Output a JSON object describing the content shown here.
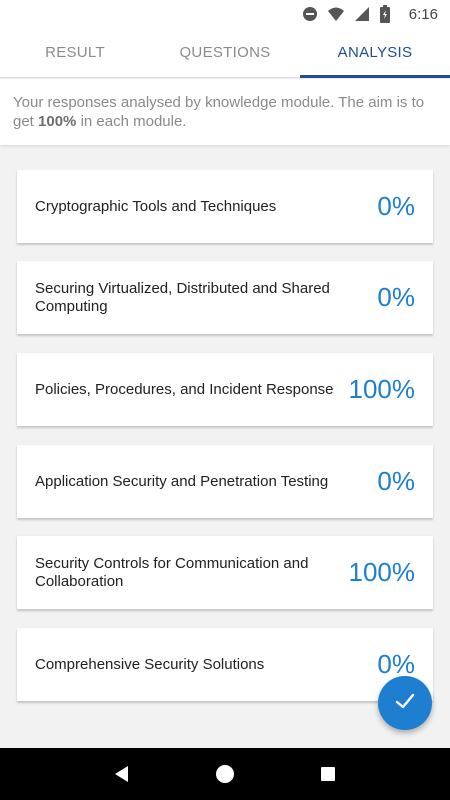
{
  "status_bar": {
    "time": "6:16",
    "icons": [
      "do-not-disturb-icon",
      "wifi-icon",
      "signal-icon",
      "battery-icon"
    ]
  },
  "tabs": [
    {
      "label": "RESULT",
      "active": false
    },
    {
      "label": "QUESTIONS",
      "active": false
    },
    {
      "label": "ANALYSIS",
      "active": true
    }
  ],
  "intro": {
    "text_before": "Your responses analysed by knowledge module. The aim is to get ",
    "bold": "100%",
    "text_after": " in each module."
  },
  "modules": [
    {
      "name": "Cryptographic Tools and Techniques",
      "score": "0%"
    },
    {
      "name": "Securing Virtualized, Distributed and Shared Computing",
      "score": "0%"
    },
    {
      "name": "Policies, Procedures, and Incident Response",
      "score": "100%"
    },
    {
      "name": "Application Security and Penetration Testing",
      "score": "0%"
    },
    {
      "name": "Security Controls for Communication and Collaboration",
      "score": "100%"
    },
    {
      "name": "Comprehensive Security Solutions",
      "score": "0%"
    }
  ],
  "fab": {
    "icon": "check-icon"
  },
  "nav_bar": {
    "icons": [
      "back-icon",
      "home-icon",
      "recents-icon"
    ]
  },
  "colors": {
    "accent": "#1f4e96",
    "score": "#1e7fd0",
    "fab": "#1e7fd0"
  }
}
